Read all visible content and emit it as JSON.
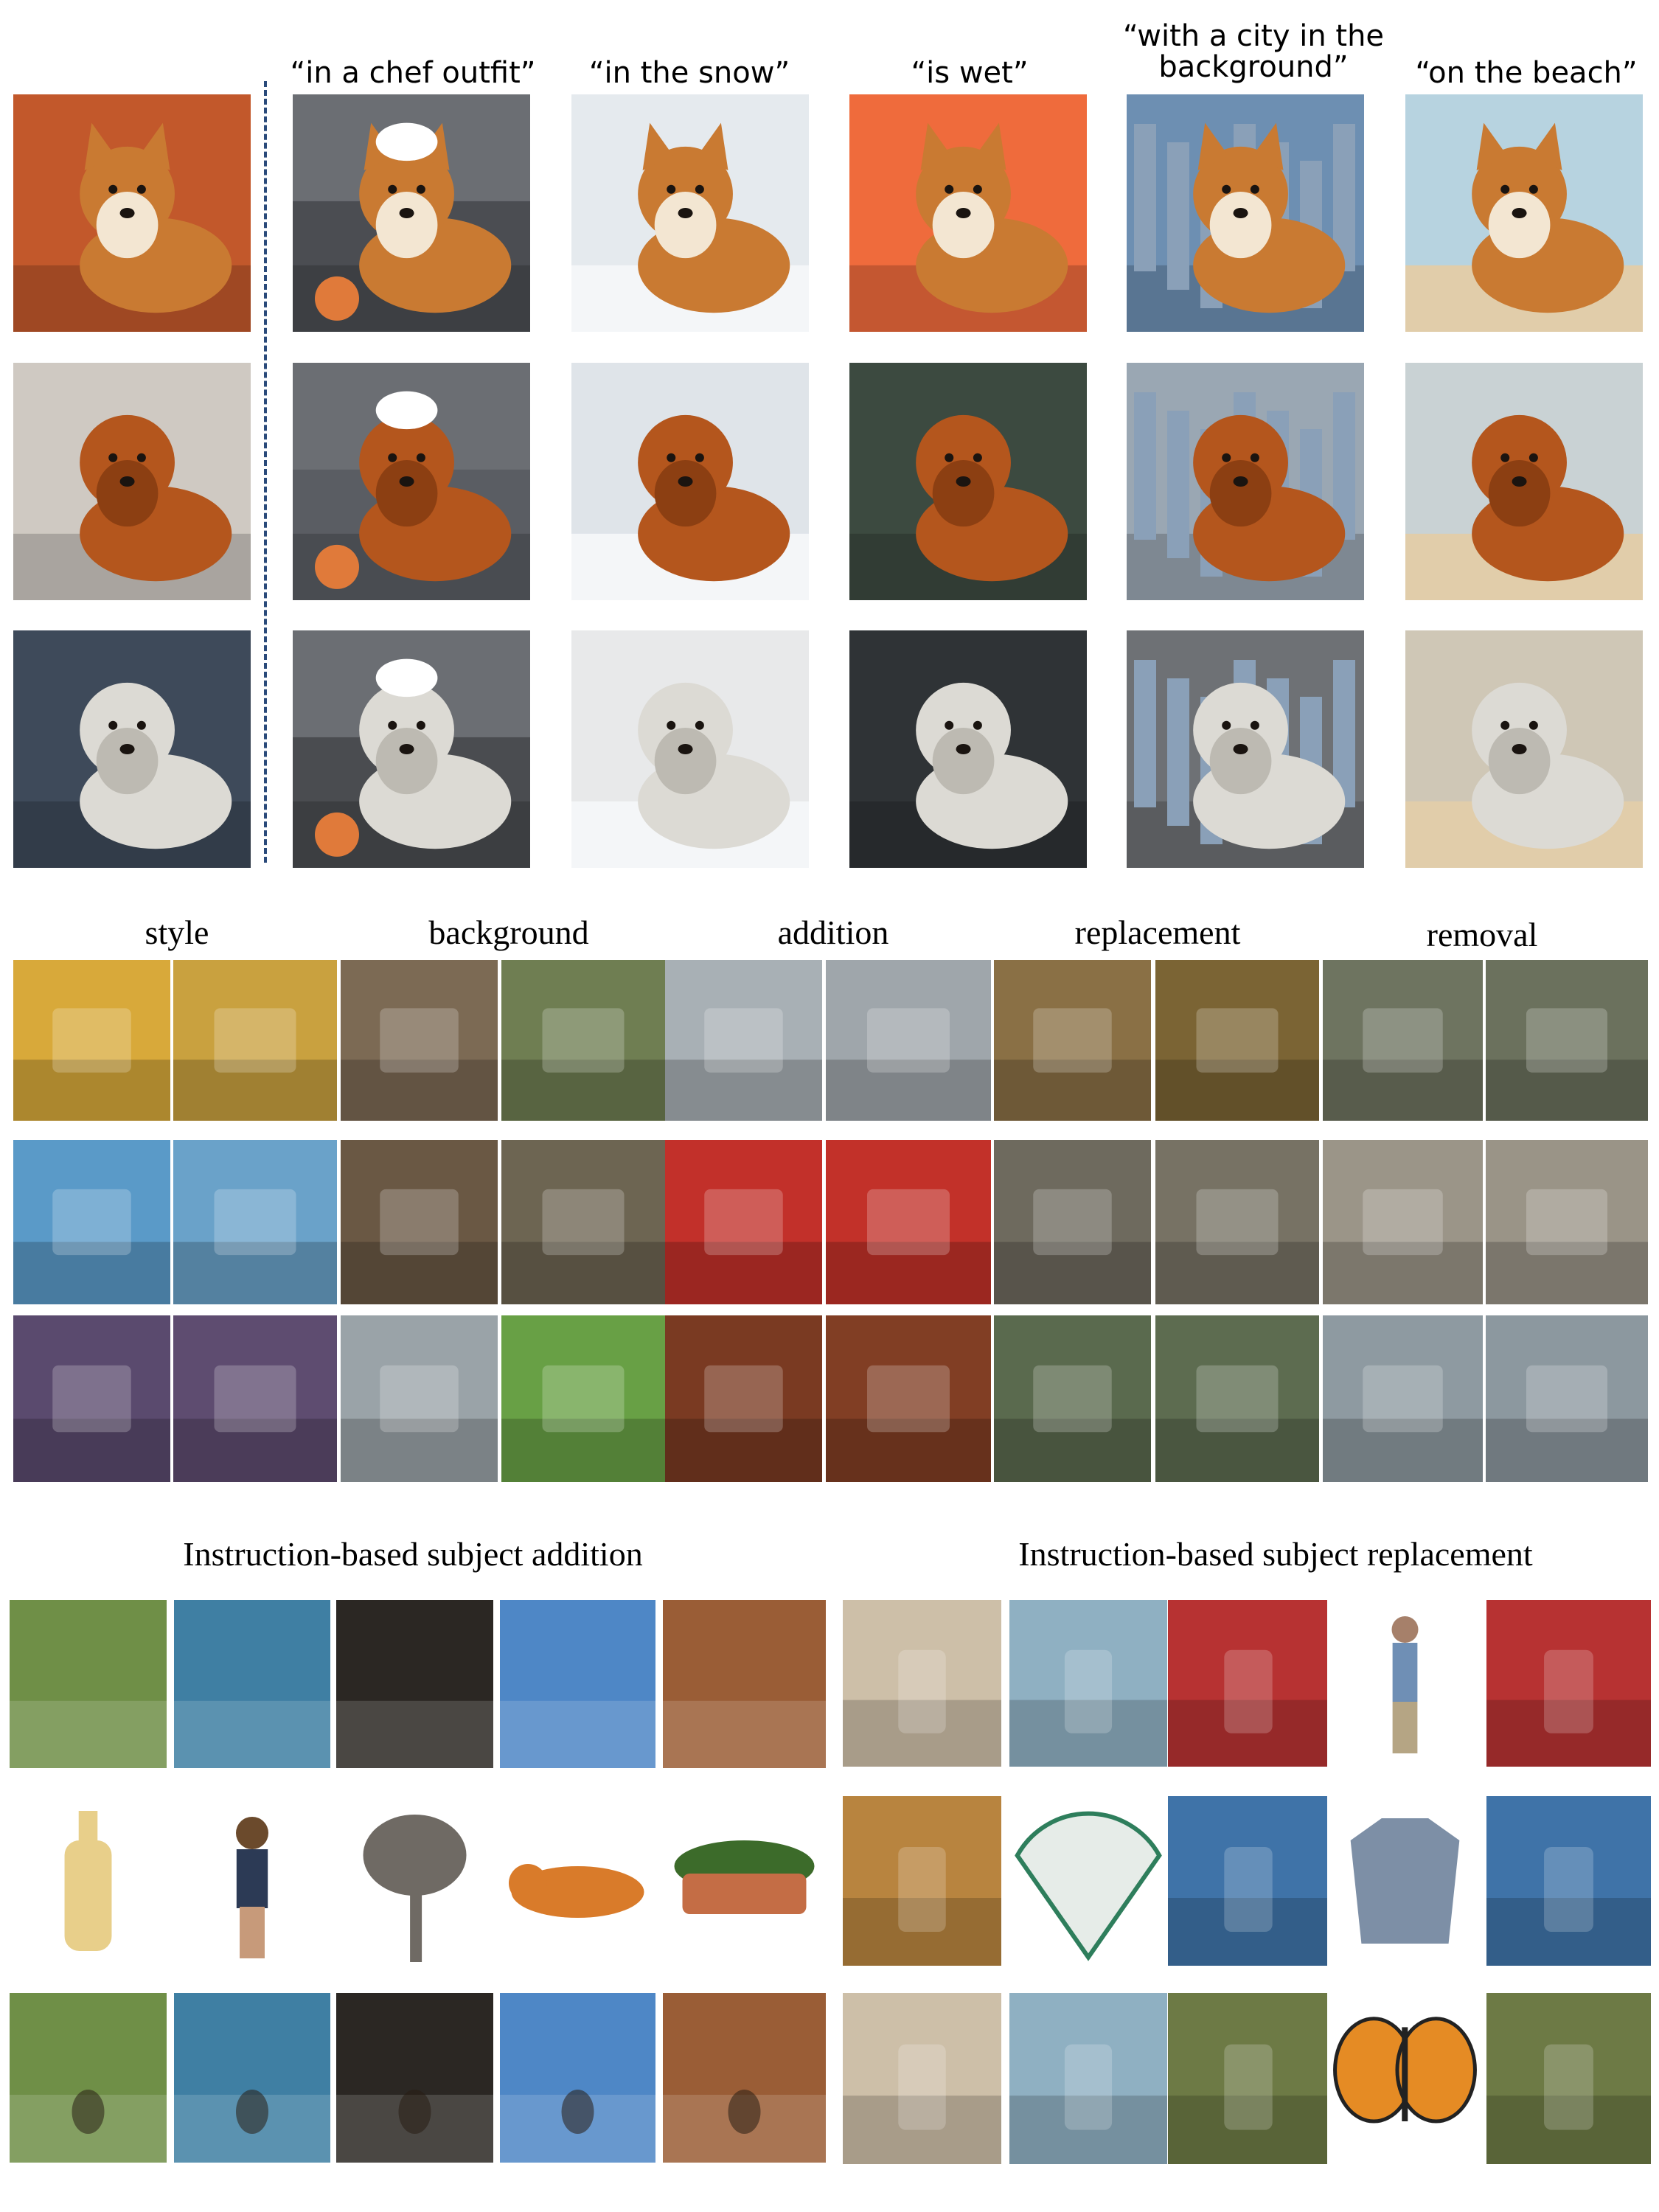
{
  "section1": {
    "captions": [
      "“in a chef outfit”",
      "“in the snow”",
      "“is wet”",
      "“with a city in the background”",
      "“on the beach”"
    ],
    "rows": [
      {
        "subject": "corgi",
        "fur": "#c97a32",
        "chest": "#f3e6d2"
      },
      {
        "subject": "chow chow",
        "fur": "#b4561d",
        "chest": "#8c3f12"
      },
      {
        "subject": "white poodle",
        "fur": "#dcdad4",
        "chest": "#bdbab2"
      }
    ],
    "backgrounds": [
      [
        "#c2582b",
        "#4b4d52",
        "#e5eaee",
        "#ef6b3c",
        "#6d8fb2",
        "#b7d3e0"
      ],
      [
        "#cfc9c2",
        "#5a5d63",
        "#dfe4e9",
        "#3c4a40",
        "#9aa7b3",
        "#c9d2d4"
      ],
      [
        "#3e4a5a",
        "#4a4c50",
        "#e8e9ea",
        "#2f3336",
        "#6e7175",
        "#cfc7b6"
      ]
    ]
  },
  "section2": {
    "headers": [
      "style",
      "background",
      "addition",
      "replacement",
      "removal"
    ],
    "tiles": [
      [
        "#d8a93a",
        "#c9a13f",
        "#7c6a54",
        "#6f7e52",
        "#a8b0b5",
        "#9fa6ab",
        "#8a7045",
        "#7b6434",
        "#6e7460",
        "#6b715d"
      ],
      [
        "#5a9ac8",
        "#6aa2c9",
        "#6a5844",
        "#6d6552",
        "#c2302a",
        "#c23129",
        "#6e6a5e",
        "#777264",
        "#9b9588",
        "#9a9487"
      ],
      [
        "#5a4a6e",
        "#5e4c70",
        "#9aa3a8",
        "#68a045",
        "#7a3a22",
        "#813e24",
        "#5a6a4e",
        "#5d6c50",
        "#8e9aa1",
        "#8c989f"
      ]
    ]
  },
  "section3": {
    "left_title": "Instruction-based subject addition",
    "right_title": "Instruction-based subject replacement",
    "addition_scenes": [
      "#6f8f47",
      "#3f7fa3",
      "#2b2723",
      "#4e87c6",
      "#9a5d36"
    ],
    "addition_objects": [
      "bottle",
      "woman",
      "elephant",
      "tiger",
      "flower-pot"
    ],
    "replacement_row1": [
      "#cdbfa8",
      "#8fb0c2",
      "#b73232",
      "person",
      "#b73232"
    ],
    "replacement_row2": [
      "#b8843f",
      "fan",
      "#3f73a8",
      "shirt",
      "#3f73a8"
    ],
    "replacement_row3": [
      "#cdbfa8",
      "#8fb0c2",
      "#6d7a45",
      "butterfly",
      "#6d7a45"
    ]
  }
}
